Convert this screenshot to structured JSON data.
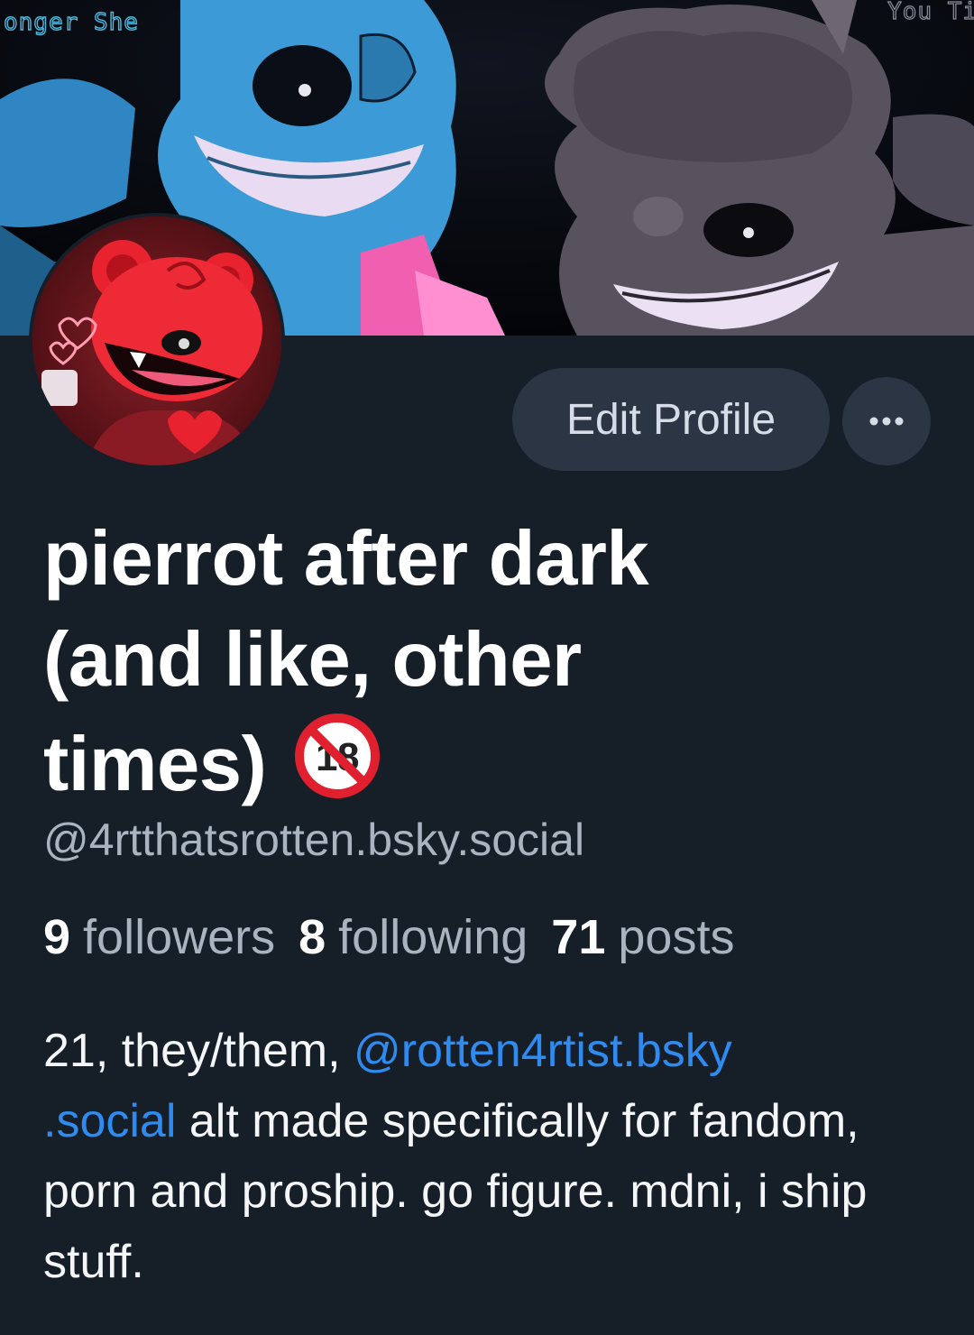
{
  "banner": {
    "text_left": "onger She",
    "text_right": "You Ti"
  },
  "profile": {
    "display_name_line1": "pierrot after dark",
    "display_name_line2": "(and like, other",
    "display_name_line3": "times)",
    "handle": "@4rtthatsrotten.bsky.social",
    "adult_badge_label": "18"
  },
  "actions": {
    "edit_profile": "Edit Profile",
    "more": "···"
  },
  "stats": {
    "followers_count": "9",
    "followers_label": "followers",
    "following_count": "8",
    "following_label": "following",
    "posts_count": "71",
    "posts_label": "posts"
  },
  "bio": {
    "part1": "21, they/them, ",
    "mention_line1": "@rotten4rtist.bsky",
    "mention_line2": ".social",
    "part2": " alt made specifically for fandom, porn and proship. go figure. mdni, i ship stuff."
  },
  "colors": {
    "background": "#161e27",
    "button": "#2b3544",
    "link": "#2f8bf0",
    "muted_text": "#aab4c0"
  }
}
